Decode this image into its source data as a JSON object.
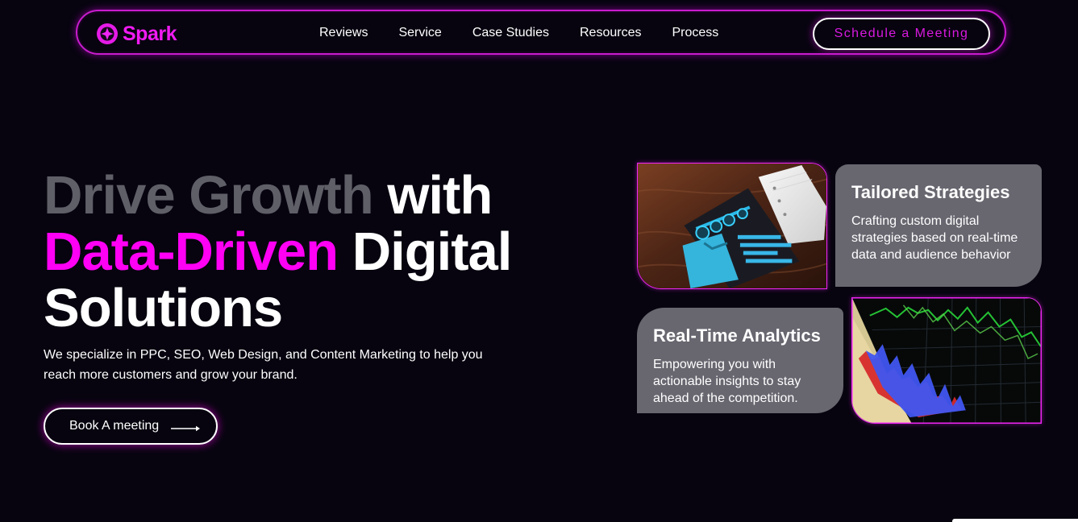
{
  "brand": {
    "name": "Spark",
    "icon": "spark-logo-icon",
    "accent": "#ff00f4"
  },
  "navigation": {
    "items": [
      {
        "label": "Reviews"
      },
      {
        "label": "Service"
      },
      {
        "label": "Case Studies"
      },
      {
        "label": "Resources"
      },
      {
        "label": "Process"
      }
    ],
    "cta_label": "Schedule a Meeting"
  },
  "hero": {
    "title_gray": "Drive Growth",
    "title_white_1": "with",
    "title_pink": "Data-Driven",
    "title_white_2": "Digital",
    "title_white_3": "Solutions",
    "description": "We specialize in PPC, SEO, Web Design, and Content Marketing to help you reach more customers and grow your brand.",
    "button_label": "Book A meeting",
    "button_icon": "arrow-right-icon"
  },
  "cards": [
    {
      "title": "Tailored Strategies",
      "text": "Crafting custom digital strategies based on real-time data and audience behavior"
    },
    {
      "title": "Real-Time Analytics",
      "text": "Empowering you with actionable insights to stay ahead of the competition."
    }
  ],
  "colors": {
    "background": "#07040f",
    "card": "#68666f",
    "muted_title": "#5f5f68",
    "outline": "#c81ccd"
  }
}
